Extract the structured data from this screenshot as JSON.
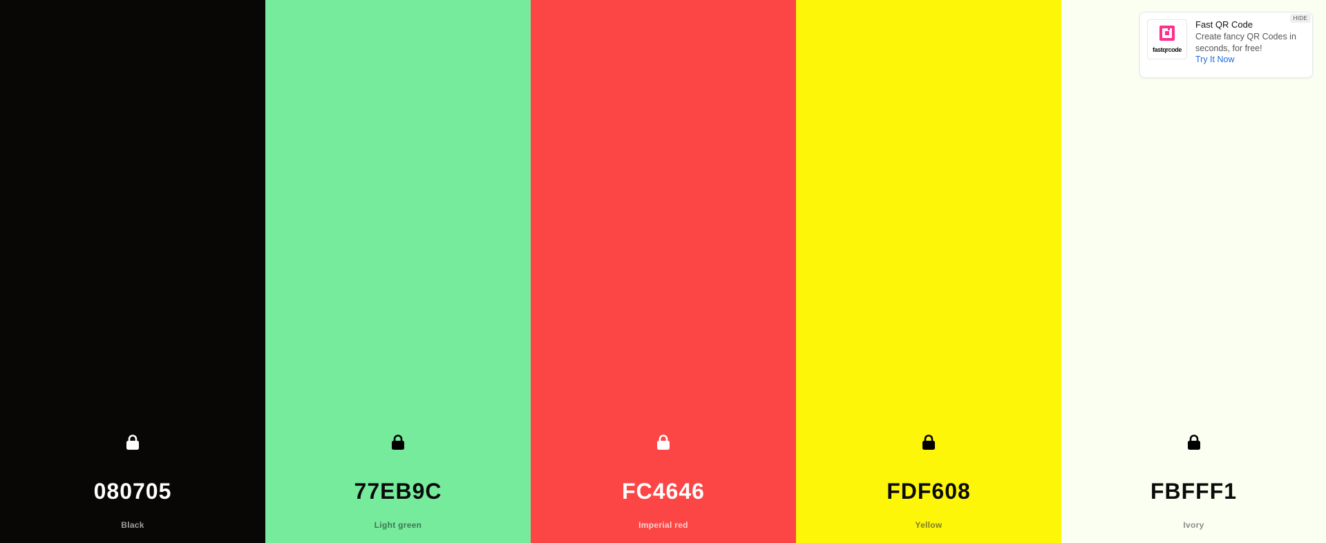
{
  "palette": {
    "colors": [
      {
        "hex": "080705",
        "name": "Black",
        "bg": "#080705",
        "text_color": "#ffffff",
        "name_color": "#a0a0a0",
        "lock_color": "#ffffff",
        "lock_icon": "lock-icon"
      },
      {
        "hex": "77EB9C",
        "name": "Light green",
        "bg": "#77EB9C",
        "text_color": "#0a0a0a",
        "name_color": "#3f7552",
        "lock_color": "#000000",
        "lock_icon": "lock-icon"
      },
      {
        "hex": "FC4646",
        "name": "Imperial red",
        "bg": "#FC4646",
        "text_color": "#ffffff",
        "name_color": "#fdd0d0",
        "lock_color": "#ffffff",
        "lock_icon": "lock-icon"
      },
      {
        "hex": "FDF608",
        "name": "Yellow",
        "bg": "#FDF608",
        "text_color": "#0a0a0a",
        "name_color": "#7e7b2a",
        "lock_color": "#000000",
        "lock_icon": "lock-icon"
      },
      {
        "hex": "FBFFF1",
        "name": "Ivory",
        "bg": "#FBFFF1",
        "text_color": "#0a0a0a",
        "name_color": "#8a8c86",
        "lock_color": "#000000",
        "lock_icon": "lock-icon"
      }
    ]
  },
  "ad": {
    "title": "Fast QR Code",
    "description": "Create fancy QR Codes in seconds, for free!",
    "link_label": "Try It Now",
    "hide_label": "HIDE",
    "logo_text": "fastqrcode",
    "logo_accent": "#ff2f8d",
    "link_color": "#1a6ae6"
  }
}
